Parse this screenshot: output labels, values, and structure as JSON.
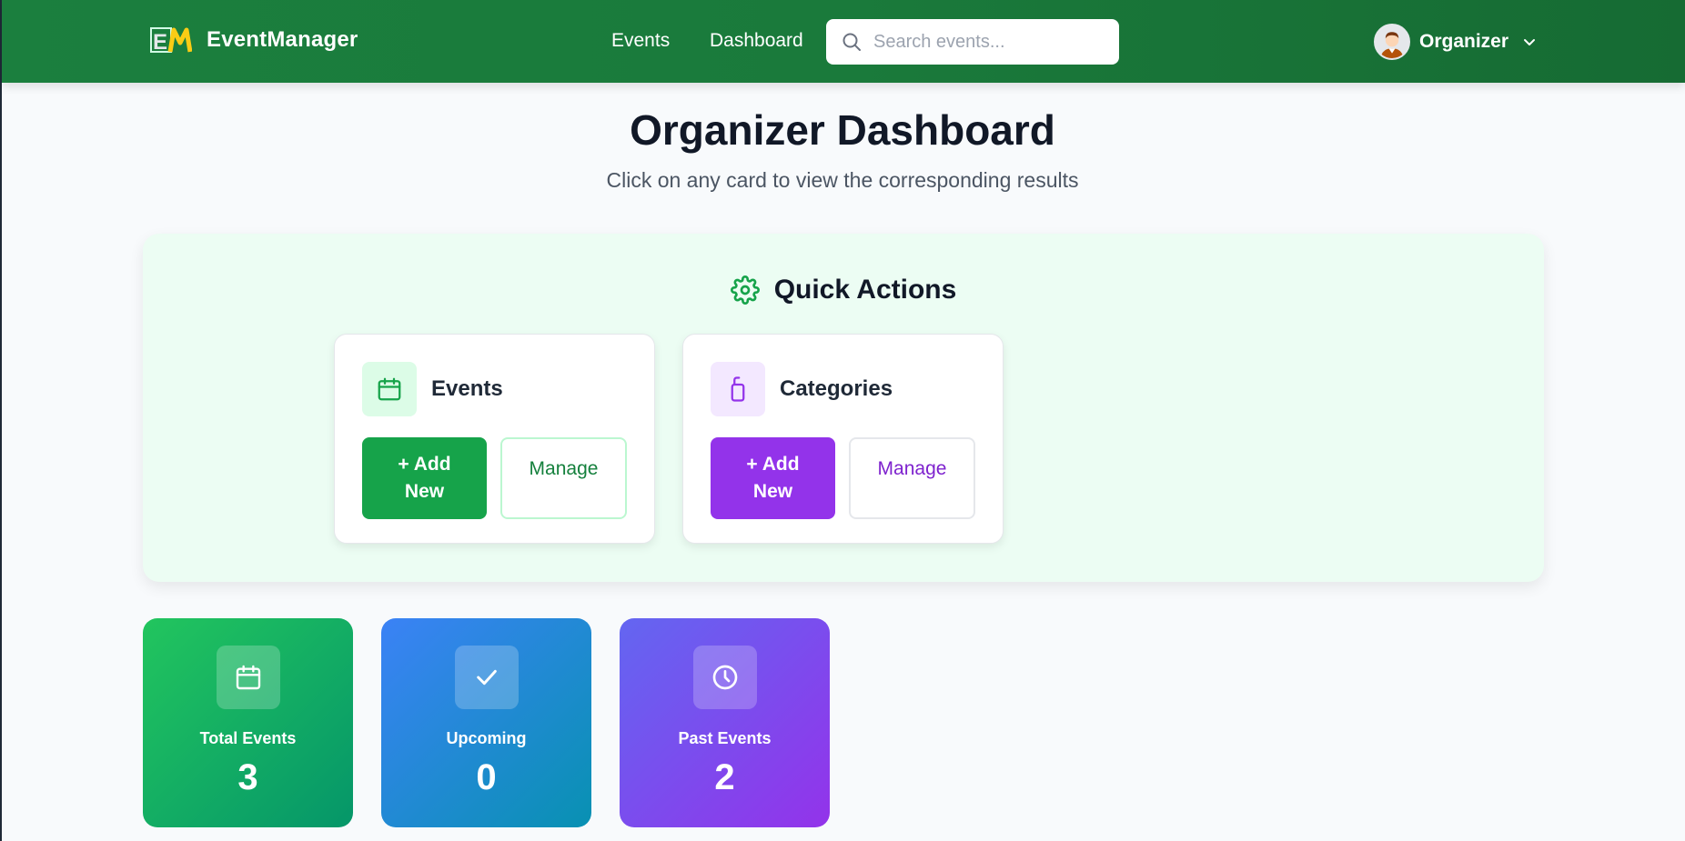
{
  "navbar": {
    "brand_name": "EventManager",
    "logo_text": "EM",
    "links": [
      {
        "label": "Events"
      },
      {
        "label": "Dashboard"
      }
    ],
    "search": {
      "placeholder": "Search events...",
      "value": ""
    },
    "user": {
      "name": "Organizer"
    }
  },
  "header": {
    "title": "Organizer Dashboard",
    "subtitle": "Click on any card to view the corresponding results"
  },
  "quick_actions": {
    "title": "Quick Actions",
    "cards": [
      {
        "label": "Events",
        "add_label": "+ Add New",
        "manage_label": "Manage"
      },
      {
        "label": "Categories",
        "add_label": "+ Add New",
        "manage_label": "Manage"
      }
    ]
  },
  "stats": [
    {
      "label": "Total Events",
      "value": "3"
    },
    {
      "label": "Upcoming",
      "value": "0"
    },
    {
      "label": "Past Events",
      "value": "2"
    }
  ],
  "colors": {
    "nav_green": "#1b7f3e",
    "accent_green": "#16a34a",
    "accent_purple": "#9333ea",
    "qa_background": "#ecfdf3"
  },
  "icons": {
    "logo": "em-logo-icon",
    "search": "search-icon",
    "avatar": "avatar-icon",
    "dropdown": "chevron-down-icon",
    "quick_actions": "gear-icon",
    "events": "calendar-icon",
    "categories": "tag-icon",
    "total": "calendar-icon",
    "upcoming": "check-icon",
    "past": "clock-icon"
  }
}
